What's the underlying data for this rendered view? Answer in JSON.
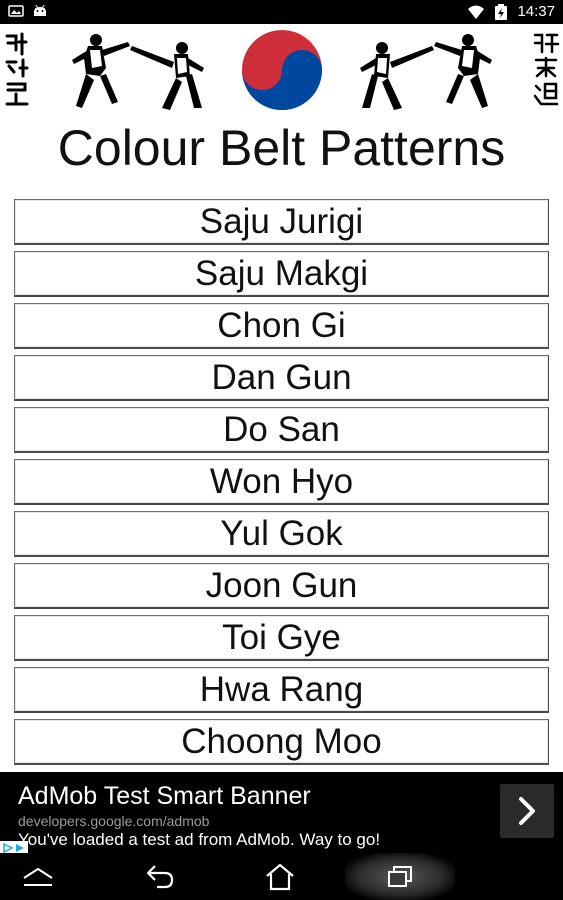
{
  "status_bar": {
    "time": "14:37",
    "left_icons": [
      "photo-icon",
      "android-icon"
    ],
    "right_icons": [
      "wifi-icon",
      "battery-charging-icon"
    ]
  },
  "banner": {
    "images": [
      "taekwondo-hangul-calligraphy",
      "kicking-fighters-left",
      "taeguk-yin-yang-symbol",
      "kicking-fighters-right",
      "taekwondo-hanja-calligraphy"
    ],
    "colors": {
      "taeguk_red": "#cd2e3a",
      "taeguk_blue": "#0047a0"
    }
  },
  "page": {
    "title": "Colour Belt Patterns"
  },
  "patterns": [
    {
      "label": "Saju Jurigi"
    },
    {
      "label": "Saju Makgi"
    },
    {
      "label": "Chon Gi"
    },
    {
      "label": "Dan Gun"
    },
    {
      "label": "Do San"
    },
    {
      "label": "Won Hyo"
    },
    {
      "label": "Yul Gok"
    },
    {
      "label": "Joon Gun"
    },
    {
      "label": "Toi Gye"
    },
    {
      "label": "Hwa Rang"
    },
    {
      "label": "Choong Moo"
    }
  ],
  "ad": {
    "title": "AdMob Test Smart Banner",
    "url": "developers.google.com/admob",
    "description": "You've loaded a test ad from AdMob. Way to go!",
    "arrow_icon": "chevron-right-icon"
  },
  "nav_bar": {
    "icons": [
      "home-caret-icon",
      "back-icon",
      "home-icon",
      "recents-icon"
    ]
  }
}
